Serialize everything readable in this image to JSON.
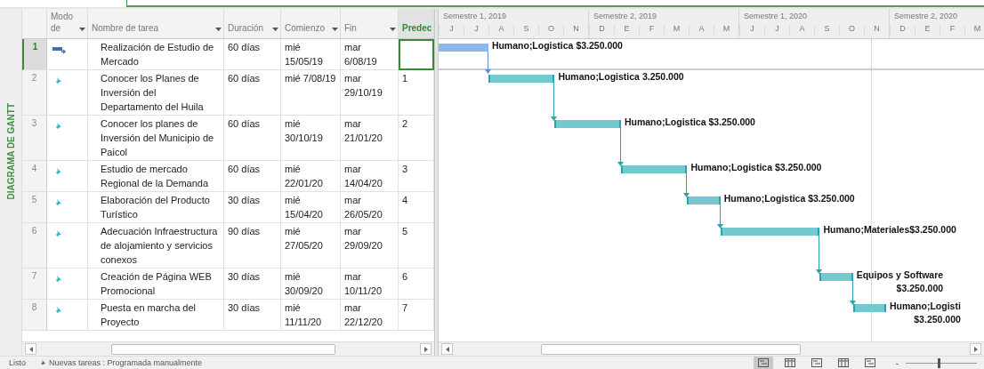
{
  "side_label": "DIAGRAMA DE GANTT",
  "columns": [
    {
      "label": "Modo de",
      "active": false
    },
    {
      "label": "Nombre de tarea",
      "active": false
    },
    {
      "label": "Duración",
      "active": false
    },
    {
      "label": "Comienzo",
      "active": false
    },
    {
      "label": "Fin",
      "active": false
    },
    {
      "label": "Predec",
      "active": true
    }
  ],
  "timescale": {
    "semesters": [
      {
        "label": "Semestre 1, 2019",
        "months": [
          "J",
          "J",
          "A",
          "S",
          "O",
          "N"
        ]
      },
      {
        "label": "Semestre 2, 2019",
        "months": [
          "D",
          "E",
          "F",
          "M",
          "A",
          "M"
        ]
      },
      {
        "label": "Semestre 1, 2020",
        "months": [
          "J",
          "J",
          "A",
          "S",
          "O",
          "N"
        ]
      },
      {
        "label": "Semestre 2, 2020",
        "months": [
          "D",
          "E",
          "F",
          "M"
        ]
      }
    ]
  },
  "tasks": [
    {
      "id": "1",
      "kind": "auto",
      "selected": true,
      "name": "Realización de Estudio de Mercado",
      "duration": "60 días",
      "start": "mié 15/05/19",
      "finish": "mar 6/08/19",
      "bar_label": [
        "Humano;Logistica $3.250.000"
      ]
    },
    {
      "id": "2",
      "kind": "manual",
      "selected": false,
      "name": "Conocer los Planes de Inversión del Departamento del Huila",
      "duration": "60 días",
      "start": "mié 7/08/19",
      "finish": "mar 29/10/19",
      "predecessors": "1",
      "bar_label": [
        "Humano;Logistica 3.250.000"
      ]
    },
    {
      "id": "3",
      "kind": "manual",
      "selected": false,
      "name": "Conocer los planes de Inversión del Municipio de Paicol",
      "duration": "60 días",
      "start": "mié 30/10/19",
      "finish": "mar 21/01/20",
      "predecessors": "2",
      "bar_label": [
        "Humano;Logistica $3.250.000"
      ]
    },
    {
      "id": "4",
      "kind": "manual",
      "selected": false,
      "name": "Estudio de mercado Regional de la Demanda",
      "duration": "60 días",
      "start": "mié 22/01/20",
      "finish": "mar 14/04/20",
      "predecessors": "3",
      "bar_label": [
        "Humano;Logistica $3.250.000"
      ]
    },
    {
      "id": "5",
      "kind": "manual",
      "selected": false,
      "name": "Elaboración del Producto Turístico",
      "duration": "30 días",
      "start": "mié 15/04/20",
      "finish": "mar 26/05/20",
      "predecessors": "4",
      "bar_label": [
        "Humano;Logistica $3.250.000"
      ]
    },
    {
      "id": "6",
      "kind": "manual",
      "selected": false,
      "name": "Adecuación Infraestructura de alojamiento y servicios conexos",
      "duration": "90 días",
      "start": "mié 27/05/20",
      "finish": "mar 29/09/20",
      "predecessors": "5",
      "bar_label": [
        "Humano;Materiales$3.250.000"
      ]
    },
    {
      "id": "7",
      "kind": "manual",
      "selected": false,
      "name": "Creación de Página WEB Promocional",
      "duration": "30 días",
      "start": "mié 30/09/20",
      "finish": "mar 10/11/20",
      "predecessors": "6",
      "bar_label": [
        "Equipos y Software",
        "$3.250.000"
      ]
    },
    {
      "id": "8",
      "kind": "manual",
      "selected": false,
      "name": "Puesta en marcha del Proyecto",
      "duration": "30 días",
      "start": "mié 11/11/20",
      "finish": "mar 22/12/20",
      "predecessors": "7",
      "bar_label": [
        "Humano;Logisti",
        "$3.250.000"
      ]
    }
  ],
  "status_bar": {
    "ready": "Listo",
    "new_tasks": "Nuevas tareas : Programada manualmente",
    "views": [
      {
        "selected": true
      },
      {
        "selected": false
      },
      {
        "selected": false
      },
      {
        "selected": false
      },
      {
        "selected": false
      }
    ],
    "zoom": {
      "minus": "-",
      "level": 0.45
    }
  }
}
